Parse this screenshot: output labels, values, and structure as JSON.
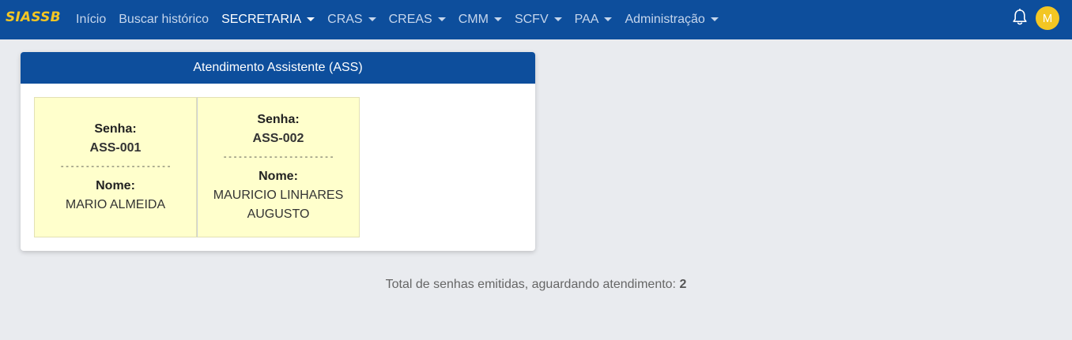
{
  "navbar": {
    "brand": "SIASSB",
    "items": [
      {
        "label": "Início",
        "dropdown": false,
        "active": false
      },
      {
        "label": "Buscar histórico",
        "dropdown": false,
        "active": false
      },
      {
        "label": "SECRETARIA",
        "dropdown": true,
        "active": true
      },
      {
        "label": "CRAS",
        "dropdown": true,
        "active": false
      },
      {
        "label": "CREAS",
        "dropdown": true,
        "active": false
      },
      {
        "label": "CMM",
        "dropdown": true,
        "active": false
      },
      {
        "label": "SCFV",
        "dropdown": true,
        "active": false
      },
      {
        "label": "PAA",
        "dropdown": true,
        "active": false
      },
      {
        "label": "Administração",
        "dropdown": true,
        "active": false
      }
    ],
    "notification_icon": "bell-icon",
    "avatar_initial": "M",
    "colors": {
      "background": "#0d4e9c",
      "brand": "#f3c623",
      "avatar": "#f3c623"
    }
  },
  "card": {
    "title": "Atendimento Assistente (ASS)",
    "tickets": [
      {
        "senha_label": "Senha:",
        "senha": "ASS-001",
        "separator": "----------------------",
        "nome_label": "Nome:",
        "nome": "MARIO ALMEIDA"
      },
      {
        "senha_label": "Senha:",
        "senha": "ASS-002",
        "separator": "----------------------",
        "nome_label": "Nome:",
        "nome": "MAURICIO LINHARES AUGUSTO"
      }
    ],
    "colors": {
      "ticket_background": "#ffffcc"
    }
  },
  "summary": {
    "label": "Total de senhas emitidas, aguardando atendimento:",
    "count": "2"
  }
}
